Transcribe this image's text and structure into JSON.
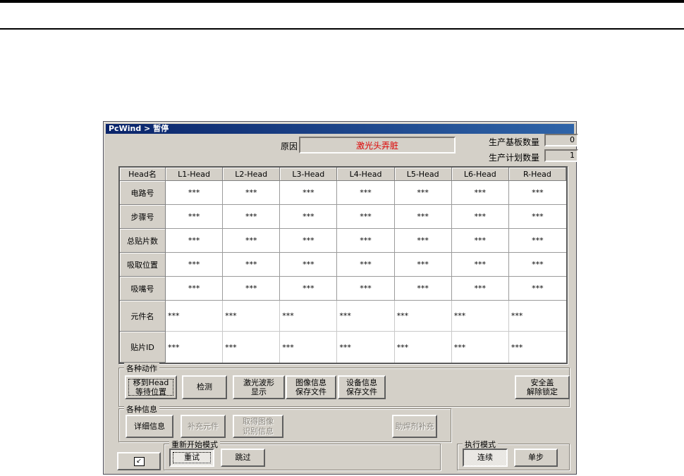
{
  "window": {
    "title": "PcWind > 暂停"
  },
  "colors": {
    "dialog_bg": "#d4d0c8",
    "titlebar_start": "#0a246a",
    "titlebar_end": "#2f64a8",
    "reason_text": "#dd0000"
  },
  "header": {
    "reason_label": "原因",
    "reason_value": "激光头弄脏",
    "counters": [
      {
        "label": "生产基板数量",
        "value": "0"
      },
      {
        "label": "生产计划数量",
        "value": "1"
      }
    ]
  },
  "table": {
    "corner": "Head名",
    "heads": [
      "L1-Head",
      "L2-Head",
      "L3-Head",
      "L4-Head",
      "L5-Head",
      "L6-Head",
      "R-Head"
    ],
    "rows": [
      {
        "label": "电路号",
        "align": "center",
        "values": [
          "***",
          "***",
          "***",
          "***",
          "***",
          "***",
          "***"
        ]
      },
      {
        "label": "步骤号",
        "align": "center",
        "values": [
          "***",
          "***",
          "***",
          "***",
          "***",
          "***",
          "***"
        ]
      },
      {
        "label": "总贴片数",
        "align": "center",
        "values": [
          "***",
          "***",
          "***",
          "***",
          "***",
          "***",
          "***"
        ]
      },
      {
        "label": "吸取位置",
        "align": "center",
        "values": [
          "***",
          "***",
          "***",
          "***",
          "***",
          "***",
          "***"
        ]
      },
      {
        "label": "吸嘴号",
        "align": "center",
        "values": [
          "***",
          "***",
          "***",
          "***",
          "***",
          "***",
          "***"
        ]
      },
      {
        "label": "元件名",
        "align": "left",
        "values": [
          "***",
          "***",
          "***",
          "***",
          "***",
          "***",
          "***"
        ]
      },
      {
        "label": "贴片ID",
        "align": "left",
        "values": [
          "***",
          "***",
          "***",
          "***",
          "***",
          "***",
          "***"
        ]
      }
    ]
  },
  "groups": {
    "actions": {
      "label": "各种动作",
      "buttons": [
        {
          "label": "移到Head\n等待位置",
          "enabled": true,
          "focused": true
        },
        {
          "label": "检测",
          "enabled": true
        },
        {
          "label": "激光波形\n显示",
          "enabled": true
        },
        {
          "label": "图像信息\n保存文件",
          "enabled": true
        },
        {
          "label": "设备信息\n保存文件",
          "enabled": true
        },
        {
          "label": "安全盖\n解除锁定",
          "enabled": true
        }
      ]
    },
    "info": {
      "label": "各种信息",
      "buttons": [
        {
          "label": "详细信息",
          "enabled": true
        },
        {
          "label": "补充元件",
          "enabled": false
        },
        {
          "label": "取得图像\n识别信息",
          "enabled": false
        },
        {
          "label": "助焊剂补充",
          "enabled": false
        }
      ]
    },
    "restart": {
      "label": "重新开始模式",
      "buttons": [
        {
          "label": "重试",
          "selected": true
        },
        {
          "label": "跳过",
          "selected": false
        }
      ]
    },
    "exec": {
      "label": "执行模式",
      "buttons": [
        {
          "label": "连续",
          "selected": true
        },
        {
          "label": "单步",
          "selected": false
        }
      ]
    }
  },
  "misc": {
    "shrink_icon_glyph": "↙"
  }
}
